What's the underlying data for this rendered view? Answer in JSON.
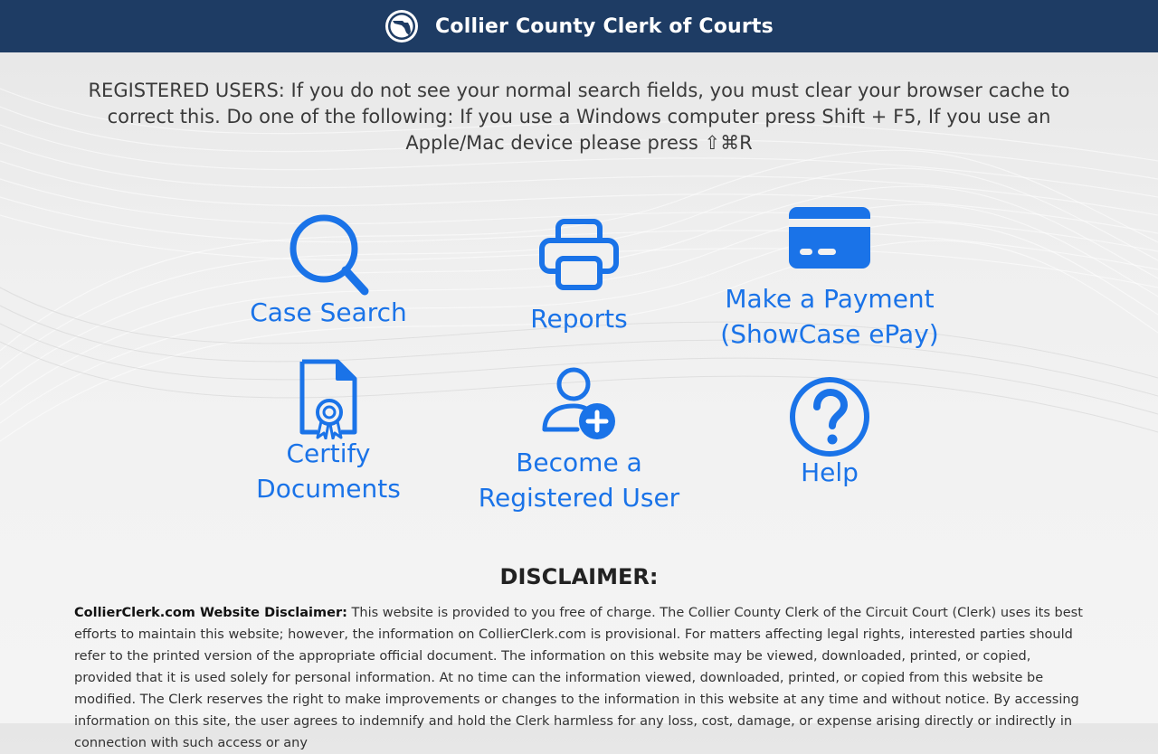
{
  "header": {
    "title": "Collier County Clerk of Courts",
    "logo_icon": "florida-seal-icon"
  },
  "notice": {
    "text": "REGISTERED USERS: If you do not see your normal search fields, you must clear your browser cache to correct this. Do one of the following: If you use a Windows computer press Shift + F5, If you use an Apple/Mac device please press ⇧⌘R"
  },
  "tiles": [
    {
      "label": "Case Search",
      "icon": "search-icon"
    },
    {
      "label": "Reports",
      "icon": "printer-icon"
    },
    {
      "label": "Make a Payment\n(ShowCase ePay)",
      "icon": "credit-card-icon"
    },
    {
      "label": "Certify\nDocuments",
      "icon": "certified-document-icon"
    },
    {
      "label": "Become a\nRegistered User",
      "icon": "add-user-icon"
    },
    {
      "label": "Help",
      "icon": "help-icon"
    }
  ],
  "disclaimer": {
    "heading": "DISCLAIMER:",
    "lead": "CollierClerk.com Website Disclaimer:",
    "body": " This website is provided to you free of charge. The Collier County Clerk of the Circuit Court (Clerk) uses its best efforts to maintain this website; however, the information on CollierClerk.com is provisional. For matters affecting legal rights, interested parties should refer to the printed version of the appropriate official document. The information on this website may be viewed, downloaded, printed, or copied, provided that it is used solely for personal information. At no time can the information viewed, downloaded, printed, or copied from this website be modified. The Clerk reserves the right to make improvements or changes to the information in this website at any time and without notice. By accessing information on this site, the user agrees to indemnify and hold the Clerk harmless for any loss, cost, damage, or expense arising directly or indirectly in connection with such access or any"
  },
  "colors": {
    "header_bg": "#1e3c64",
    "accent": "#1a73e8"
  }
}
